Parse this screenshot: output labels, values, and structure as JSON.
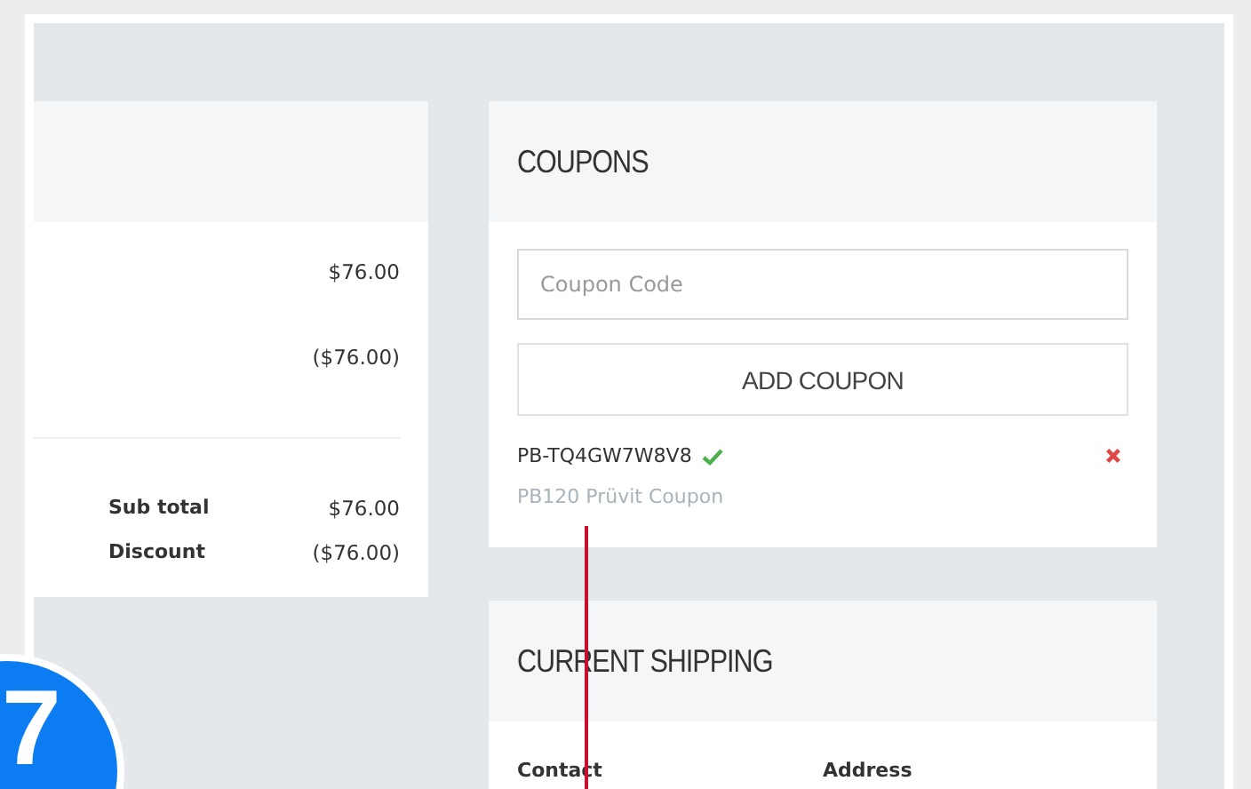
{
  "order_summary": {
    "lines": [
      {
        "amount": "$76.00"
      },
      {
        "amount": "($76.00)"
      }
    ],
    "totals": [
      {
        "label": "Sub total",
        "amount": "$76.00"
      },
      {
        "label": "Discount",
        "amount": "($76.00)"
      }
    ]
  },
  "coupons": {
    "title": "COUPONS",
    "input": {
      "placeholder": "Coupon Code"
    },
    "button": "ADD COUPON",
    "applied": [
      {
        "code": "PB-TQ4GW7W8V8",
        "valid": true,
        "description": "PB120 Prüvit Coupon"
      }
    ]
  },
  "current_shipping": {
    "title": "CURRENT SHIPPING",
    "columns": [
      "Contact",
      "Address"
    ]
  },
  "step_badge": "7"
}
